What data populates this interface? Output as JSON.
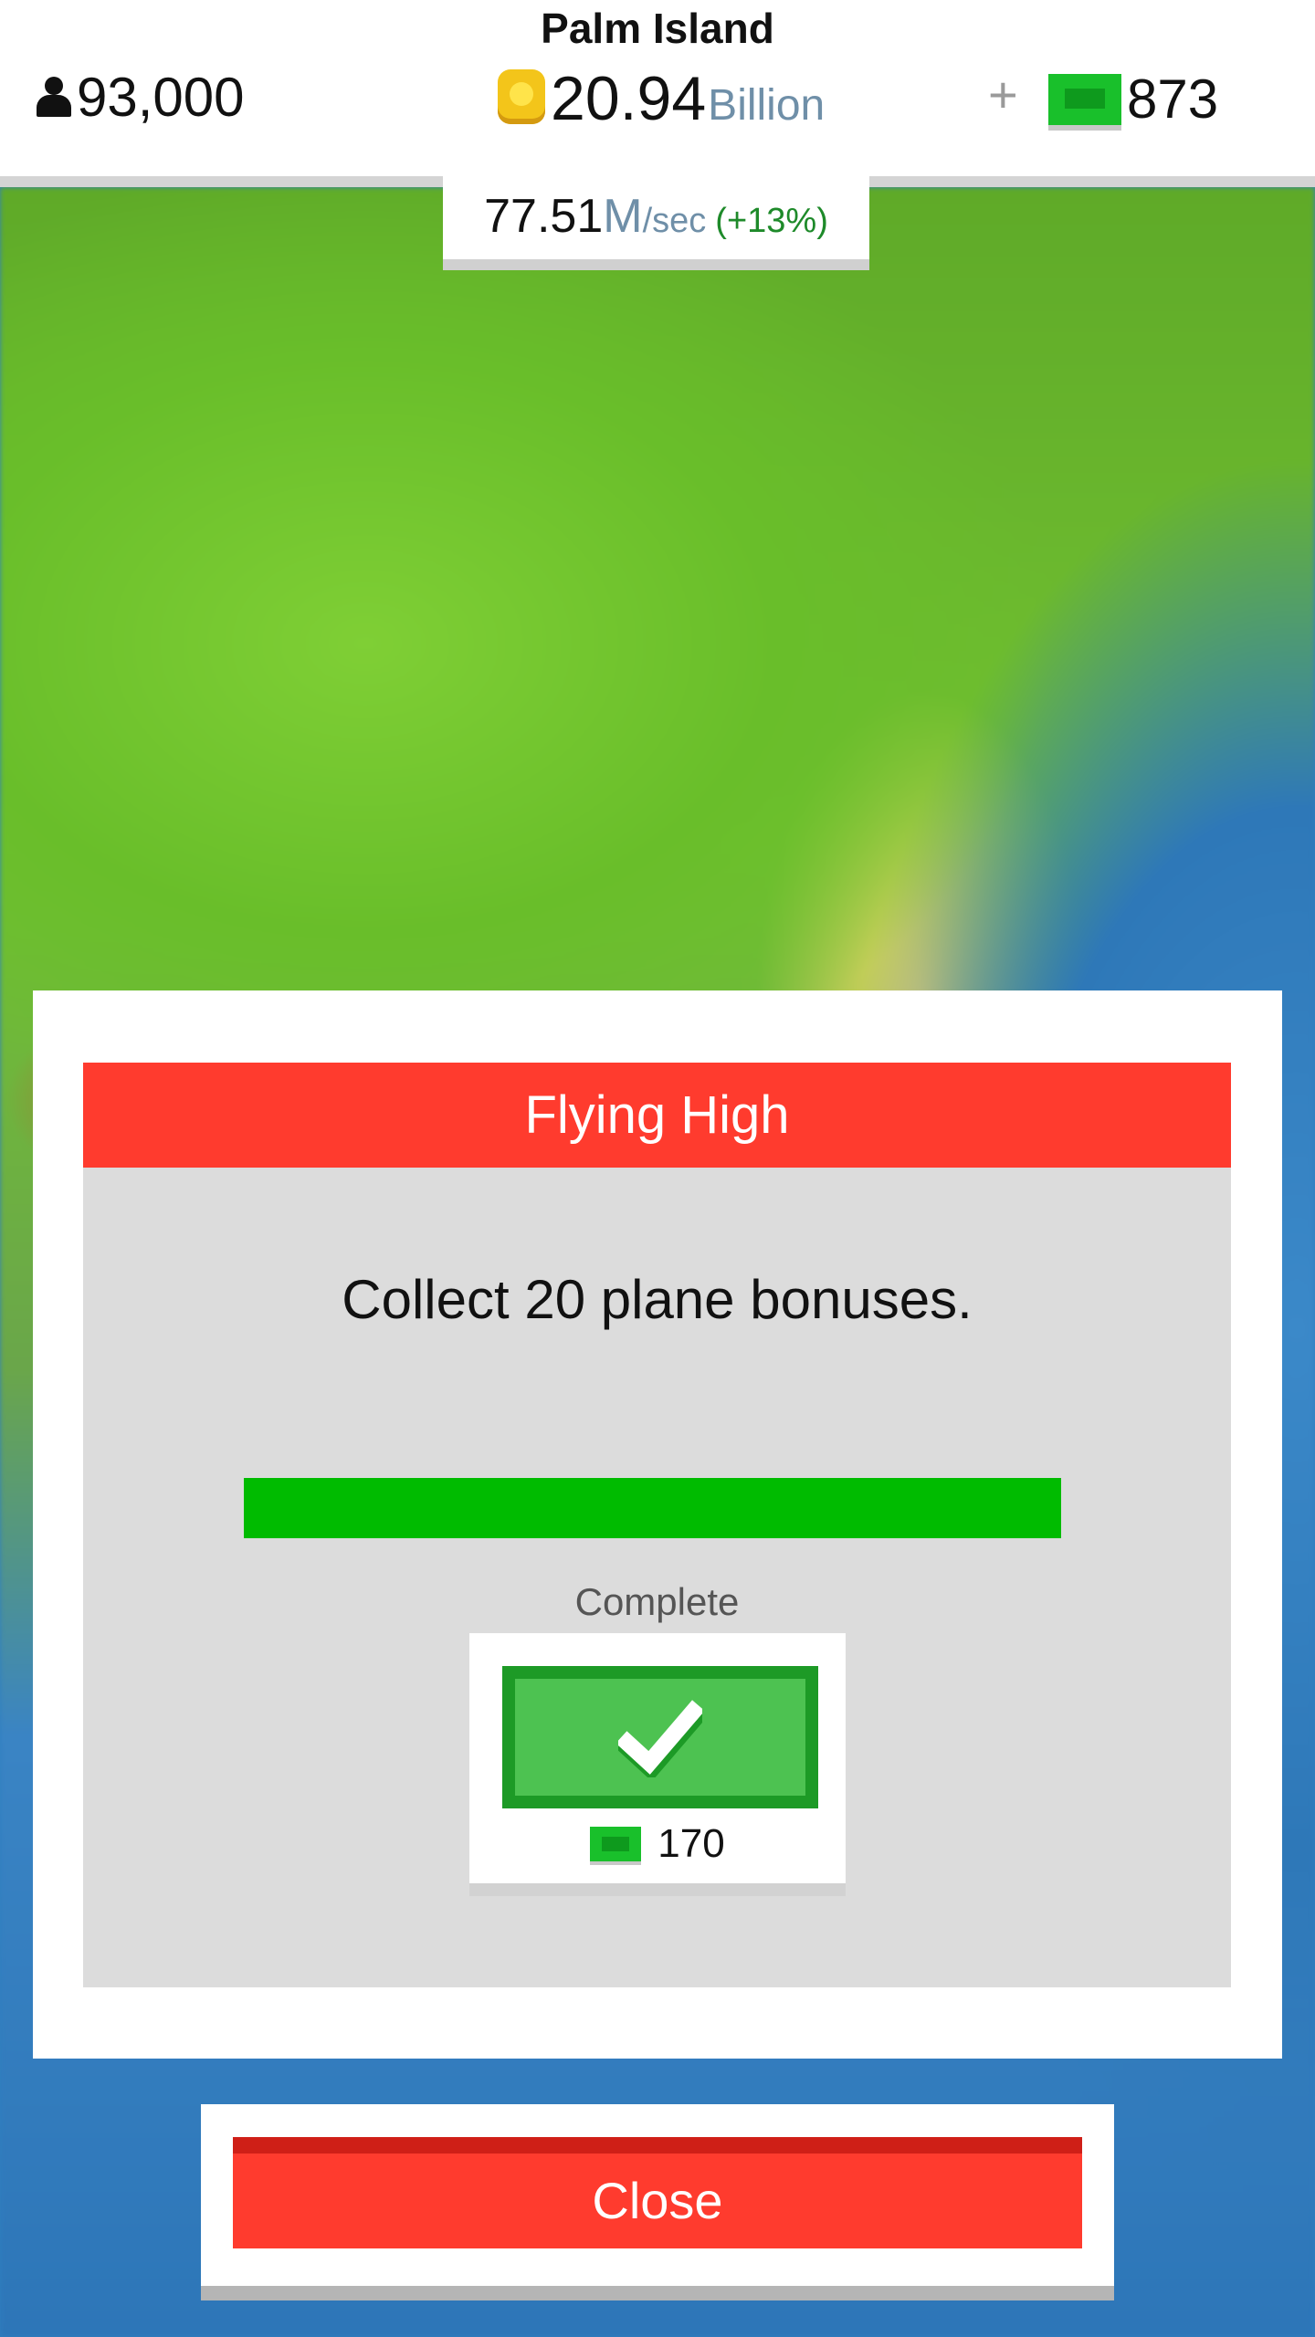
{
  "hud": {
    "island_name": "Palm Island",
    "population": "93,000",
    "money_value": "20.94",
    "money_unit": "Billion",
    "plus": "+",
    "cash": "873"
  },
  "income": {
    "value": "77.51",
    "unit": "M",
    "per": "/sec",
    "bonus": "(+13%)"
  },
  "achievement": {
    "title": "Flying High",
    "description": "Collect 20 plane bonuses.",
    "progress_fraction": 1.0,
    "status": "Complete",
    "reward": "170"
  },
  "footer": {
    "close_label": "Close"
  },
  "colors": {
    "header_red": "#ff3b2e",
    "progress_green": "#00bb00",
    "cash_green": "#19c02b",
    "coin_gold": "#f3c51a"
  },
  "icons": [
    "person-icon",
    "coin-icon",
    "cash-icon",
    "check-icon"
  ]
}
